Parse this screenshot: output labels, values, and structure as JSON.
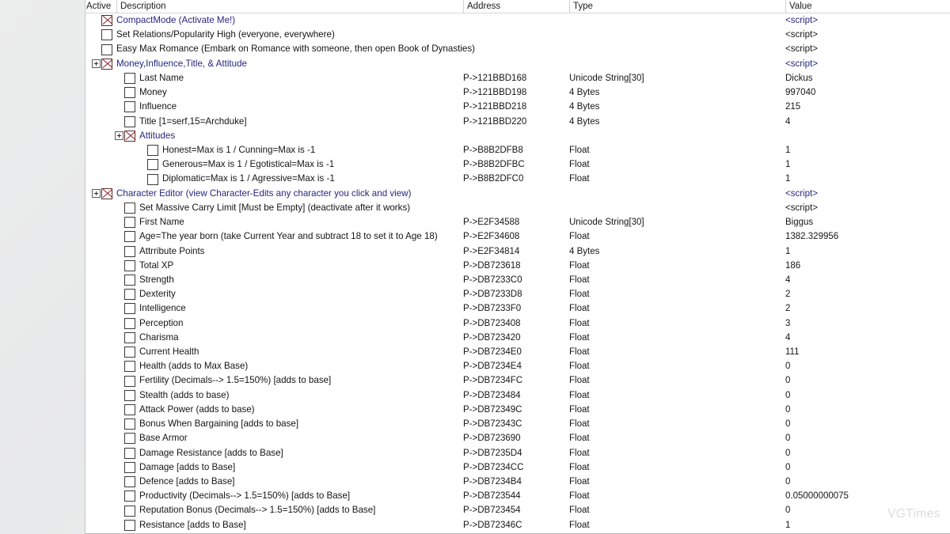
{
  "window": {
    "panel_name": "cheat-table-address-list"
  },
  "columns": {
    "active": "Active",
    "description": "Description",
    "address": "Address",
    "type": "Type",
    "value": "Value"
  },
  "colors": {
    "group_text": "#262680",
    "check_mark": "#8e1f28",
    "panel_bg": "#ffffff"
  },
  "watermark": {
    "text": "VGTimes"
  },
  "rows": [
    {
      "indent": 0,
      "expander": false,
      "checked": true,
      "description": "CompactMode (Activate  Me!)",
      "address": "",
      "type": "",
      "value": "<script>",
      "group": true
    },
    {
      "indent": 0,
      "expander": false,
      "checked": false,
      "description": "Set Relations/Popularity High  (everyone, everywhere)",
      "address": "",
      "type": "",
      "value": "<script>",
      "group": false
    },
    {
      "indent": 0,
      "expander": false,
      "checked": false,
      "description": "Easy Max Romance (Embark on Romance with someone, then open Book of Dynasties)",
      "address": "",
      "type": "",
      "value": "<script>",
      "group": false
    },
    {
      "indent": 0,
      "expander": true,
      "checked": true,
      "description": "Money,Influence,Title, & Attitude",
      "address": "",
      "type": "",
      "value": "<script>",
      "group": true
    },
    {
      "indent": 1,
      "expander": false,
      "checked": false,
      "description": "Last Name",
      "address": "P->121BBD168",
      "type": "Unicode String[30]",
      "value": "Dickus",
      "group": false
    },
    {
      "indent": 1,
      "expander": false,
      "checked": false,
      "description": "Money",
      "address": "P->121BBD198",
      "type": "4 Bytes",
      "value": "997040",
      "group": false
    },
    {
      "indent": 1,
      "expander": false,
      "checked": false,
      "description": "Influence",
      "address": "P->121BBD218",
      "type": "4 Bytes",
      "value": "215",
      "group": false
    },
    {
      "indent": 1,
      "expander": false,
      "checked": false,
      "description": "Title [1=serf,15=Archduke]",
      "address": "P->121BBD220",
      "type": "4 Bytes",
      "value": "4",
      "group": false
    },
    {
      "indent": 1,
      "expander": true,
      "checked": true,
      "description": "Attitudes",
      "address": "",
      "type": "",
      "value": "",
      "group": true
    },
    {
      "indent": 2,
      "expander": false,
      "checked": false,
      "description": "Honest=Max is 1 / Cunning=Max is -1",
      "address": "P->B8B2DFB8",
      "type": "Float",
      "value": "1",
      "group": false
    },
    {
      "indent": 2,
      "expander": false,
      "checked": false,
      "description": "Generous=Max is 1 / Egotistical=Max is -1",
      "address": "P->B8B2DFBC",
      "type": "Float",
      "value": "1",
      "group": false
    },
    {
      "indent": 2,
      "expander": false,
      "checked": false,
      "description": "Diplomatic=Max is 1 / Agressive=Max is -1",
      "address": "P->B8B2DFC0",
      "type": "Float",
      "value": "1",
      "group": false
    },
    {
      "indent": 0,
      "expander": true,
      "checked": true,
      "description": "Character Editor (view Character-Edits any character you click and view)",
      "address": "",
      "type": "",
      "value": "<script>",
      "group": true
    },
    {
      "indent": 1,
      "expander": false,
      "checked": false,
      "description": "Set Massive Carry Limit [Must be Empty] (deactivate after it works)",
      "address": "",
      "type": "",
      "value": "<script>",
      "group": false
    },
    {
      "indent": 1,
      "expander": false,
      "checked": false,
      "description": "First Name",
      "address": "P->E2F34588",
      "type": "Unicode String[30]",
      "value": "Biggus",
      "group": false
    },
    {
      "indent": 1,
      "expander": false,
      "checked": false,
      "description": "Age=The year born (take Current Year and subtract 18 to set it to Age 18)",
      "address": "P->E2F34608",
      "type": "Float",
      "value": "1382.329956",
      "group": false
    },
    {
      "indent": 1,
      "expander": false,
      "checked": false,
      "description": "Attrribute Points",
      "address": "P->E2F34814",
      "type": "4 Bytes",
      "value": "1",
      "group": false
    },
    {
      "indent": 1,
      "expander": false,
      "checked": false,
      "description": "Total XP",
      "address": "P->DB723618",
      "type": "Float",
      "value": "186",
      "group": false
    },
    {
      "indent": 1,
      "expander": false,
      "checked": false,
      "description": "Strength",
      "address": "P->DB7233C0",
      "type": "Float",
      "value": "4",
      "group": false
    },
    {
      "indent": 1,
      "expander": false,
      "checked": false,
      "description": "Dexterity",
      "address": "P->DB7233D8",
      "type": "Float",
      "value": "2",
      "group": false
    },
    {
      "indent": 1,
      "expander": false,
      "checked": false,
      "description": "Intelligence",
      "address": "P->DB7233F0",
      "type": "Float",
      "value": "2",
      "group": false
    },
    {
      "indent": 1,
      "expander": false,
      "checked": false,
      "description": "Perception",
      "address": "P->DB723408",
      "type": "Float",
      "value": "3",
      "group": false
    },
    {
      "indent": 1,
      "expander": false,
      "checked": false,
      "description": "Charisma",
      "address": "P->DB723420",
      "type": "Float",
      "value": "4",
      "group": false
    },
    {
      "indent": 1,
      "expander": false,
      "checked": false,
      "description": "Current Health",
      "address": "P->DB7234E0",
      "type": "Float",
      "value": "111",
      "group": false
    },
    {
      "indent": 1,
      "expander": false,
      "checked": false,
      "description": "Health (adds to Max Base)",
      "address": "P->DB7234E4",
      "type": "Float",
      "value": "0",
      "group": false
    },
    {
      "indent": 1,
      "expander": false,
      "checked": false,
      "description": "Fertility (Decimals--> 1.5=150%) [adds to base]",
      "address": "P->DB7234FC",
      "type": "Float",
      "value": "0",
      "group": false
    },
    {
      "indent": 1,
      "expander": false,
      "checked": false,
      "description": "Stealth (adds to base)",
      "address": "P->DB723484",
      "type": "Float",
      "value": "0",
      "group": false
    },
    {
      "indent": 1,
      "expander": false,
      "checked": false,
      "description": "Attack Power (adds to base)",
      "address": "P->DB72349C",
      "type": "Float",
      "value": "0",
      "group": false
    },
    {
      "indent": 1,
      "expander": false,
      "checked": false,
      "description": "Bonus When Bargaining [adds to base]",
      "address": "P->DB72343C",
      "type": "Float",
      "value": "0",
      "group": false
    },
    {
      "indent": 1,
      "expander": false,
      "checked": false,
      "description": "Base Armor",
      "address": "P->DB723690",
      "type": "Float",
      "value": "0",
      "group": false
    },
    {
      "indent": 1,
      "expander": false,
      "checked": false,
      "description": "Damage Resistance [adds to Base]",
      "address": "P->DB7235D4",
      "type": "Float",
      "value": "0",
      "group": false
    },
    {
      "indent": 1,
      "expander": false,
      "checked": false,
      "description": "Damage [adds to Base]",
      "address": "P->DB7234CC",
      "type": "Float",
      "value": "0",
      "group": false
    },
    {
      "indent": 1,
      "expander": false,
      "checked": false,
      "description": "Defence [adds to Base]",
      "address": "P->DB7234B4",
      "type": "Float",
      "value": "0",
      "group": false
    },
    {
      "indent": 1,
      "expander": false,
      "checked": false,
      "description": "Productivity  (Decimals--> 1.5=150%)  [adds to Base]",
      "address": "P->DB723544",
      "type": "Float",
      "value": "0.05000000075",
      "group": false
    },
    {
      "indent": 1,
      "expander": false,
      "checked": false,
      "description": "Reputation Bonus (Decimals--> 1.5=150%)  [adds to Base]",
      "address": "P->DB723454",
      "type": "Float",
      "value": "0",
      "group": false
    },
    {
      "indent": 1,
      "expander": false,
      "checked": false,
      "description": "Resistance [adds to Base]",
      "address": "P->DB72346C",
      "type": "Float",
      "value": "1",
      "group": false
    }
  ]
}
